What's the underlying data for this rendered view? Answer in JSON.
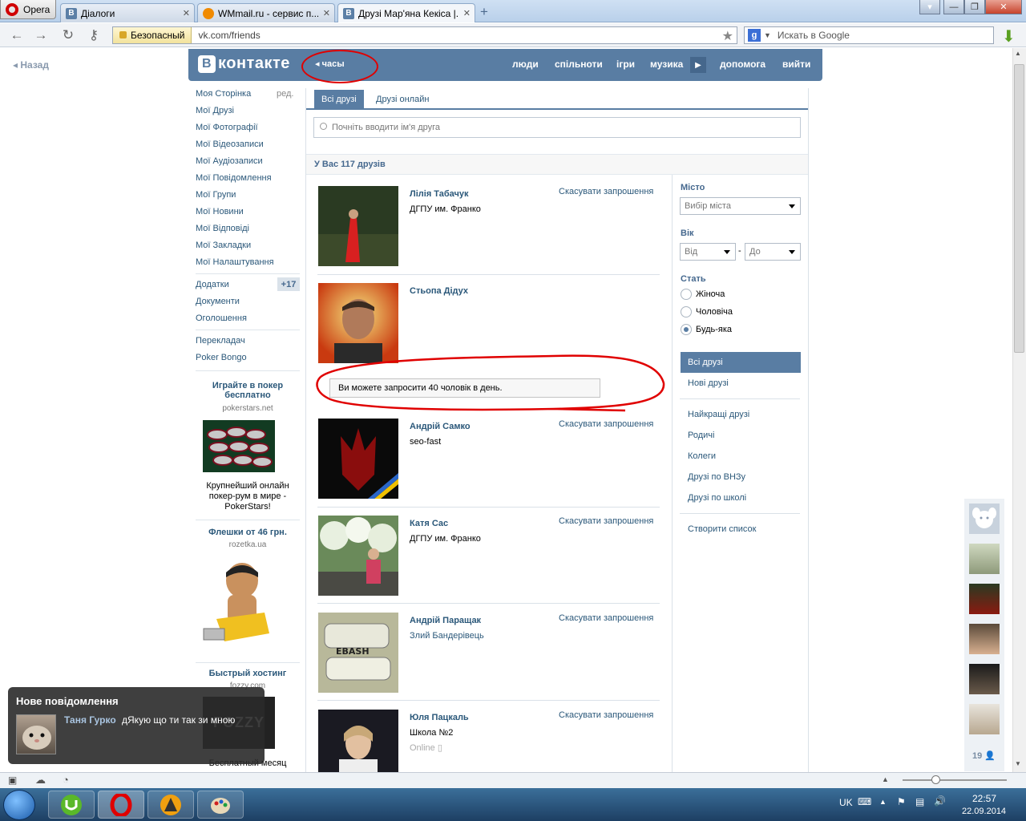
{
  "browser": {
    "menu_label": "Opera",
    "tabs": [
      {
        "title": "Діалоги",
        "fav": "В",
        "fav_color": "#5b7fa6"
      },
      {
        "title": "WMmail.ru - сервис п...",
        "fav": "",
        "fav_color": "#f08a00"
      },
      {
        "title": "Друзі Мар'яна Кекіса |...",
        "fav": "В",
        "fav_color": "#5b7fa6"
      }
    ],
    "new_tab": "+",
    "security_label": "Безопасный",
    "url": "vk.com/friends",
    "search_placeholder": "Искать в Google",
    "search_engine": "g"
  },
  "page": {
    "back_label": "Назад",
    "logo_text": "контакте",
    "logo_letter": "В",
    "clock_link": "часы",
    "nav": [
      "люди",
      "спільноти",
      "ігри",
      "музика",
      "допомога",
      "вийти"
    ]
  },
  "left_menu": {
    "items": [
      "Моя Сторінка",
      "Мої Друзі",
      "Мої Фотографії",
      "Мої Відеозаписи",
      "Мої Аудіозаписи",
      "Мої Повідомлення",
      "Мої Групи",
      "Мої Новини",
      "Мої Відповіді",
      "Мої Закладки",
      "Мої Налаштування"
    ],
    "edit_label": "ред.",
    "extra": [
      "Додатки",
      "Документи",
      "Оголошення"
    ],
    "apps_badge": "+17",
    "other": [
      "Перекладач",
      "Poker Bongo"
    ],
    "ads": [
      {
        "title": "Играйте в покер бесплатно",
        "domain": "pokerstars.net",
        "text": "Крупнейший онлайн покер-рум в мире - PokerStars!"
      },
      {
        "title": "Флешки от 46 грн.",
        "domain": "rozetka.ua",
        "text": ""
      },
      {
        "title": "Быстрый хостинг",
        "domain": "fozzy.com",
        "text": "Бесплатный месяц"
      }
    ]
  },
  "content": {
    "tabs": [
      "Всі друзі",
      "Друзі онлайн"
    ],
    "search_placeholder": "Почніть вводити ім'я друга",
    "count_label": "У Вас 117 друзів",
    "cancel_label": "Скасувати запрошення",
    "limit_message": "Ви можете запросити 40 чоловік в день.",
    "friends": [
      {
        "name": "Лілія Табачук",
        "info": "ДГПУ им. Франко",
        "has_cancel": true
      },
      {
        "name": "Стьопа Дідух",
        "info": "",
        "has_cancel": false
      },
      {
        "name": "Андрій Самко",
        "info": "seo-fast",
        "has_cancel": true
      },
      {
        "name": "Катя Сас",
        "info": "ДГПУ им. Франко",
        "has_cancel": true
      },
      {
        "name": "Андрій Паращак",
        "info": "Злий Бандерівець",
        "has_cancel": true
      },
      {
        "name": "Юля Пацкаль",
        "info": "Школа №2",
        "status": "Online",
        "has_cancel": true
      }
    ]
  },
  "filters": {
    "city_title": "Місто",
    "city_select": "Вибір міста",
    "age_title": "Вік",
    "age_from": "Від",
    "age_dash": "-",
    "age_to": "До",
    "sex_title": "Стать",
    "sex_options": [
      "Жіноча",
      "Чоловіча",
      "Будь-яка"
    ],
    "sex_selected": 2,
    "menu_active": "Всі друзі",
    "menu": [
      "Нові друзі",
      "Найкращі друзі",
      "Родичі",
      "Колеги",
      "Друзі по ВНЗу",
      "Друзі по школі",
      "Створити список"
    ]
  },
  "side_chat": {
    "online_count": "19"
  },
  "notification": {
    "title": "Нове повідомлення",
    "sender": "Таня Гурко",
    "text": "дЯкую що ти так зи мною"
  },
  "taskbar": {
    "lang": "UK",
    "time": "22:57",
    "date": "22.09.2014"
  },
  "colors": {
    "vk_blue": "#597da3",
    "link": "#2b587a",
    "annotation_red": "#e00000"
  }
}
